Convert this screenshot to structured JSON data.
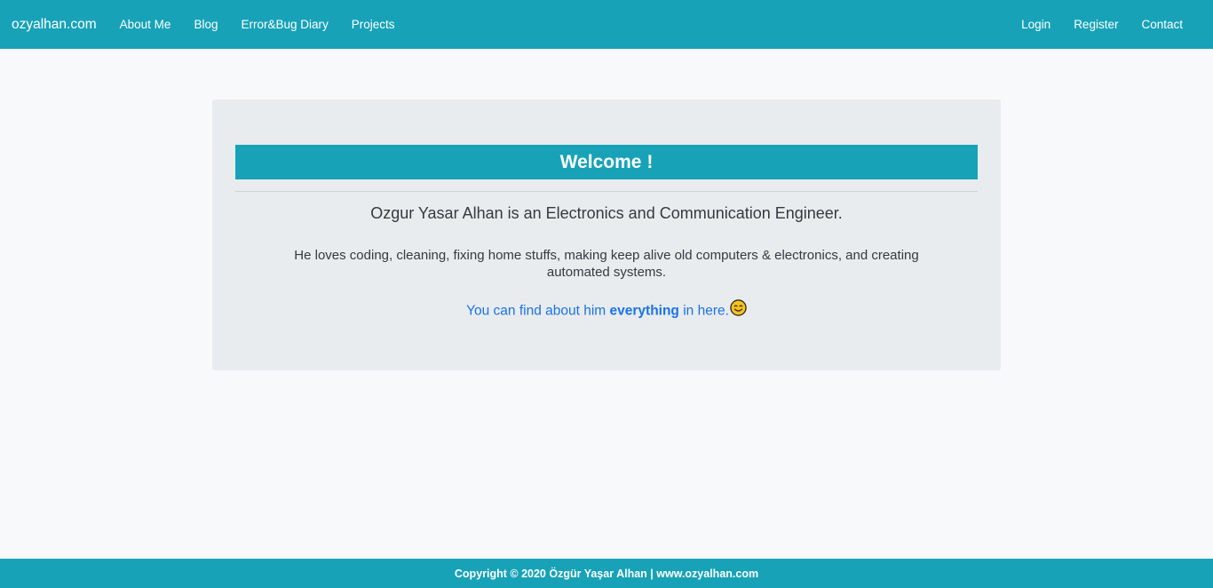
{
  "navbar": {
    "brand": "ozyalhan.com",
    "left_links": [
      "About Me",
      "Blog",
      "Error&Bug Diary",
      "Projects"
    ],
    "right_links": [
      "Login",
      "Register",
      "Contact"
    ]
  },
  "main": {
    "welcome_title": "Welcome !",
    "lead": "Ozgur Yasar Alhan is an Electronics and Communication Engineer.",
    "description": "He loves coding, cleaning, fixing home stuffs, making keep alive old computers & electronics, and creating automated systems.",
    "find_prefix": "You can find about him",
    "find_bold": "everything",
    "find_suffix": "in here.",
    "emoji_icon": "smiling-face-icon"
  },
  "footer": {
    "text": "Copyright © 2020 Özgür Yaşar Alhan | www.ozyalhan.com"
  },
  "colors": {
    "primary": "#17a2b8",
    "background": "#f8f9fa",
    "jumbotron": "#e9ecef",
    "link": "#1a73e8"
  }
}
